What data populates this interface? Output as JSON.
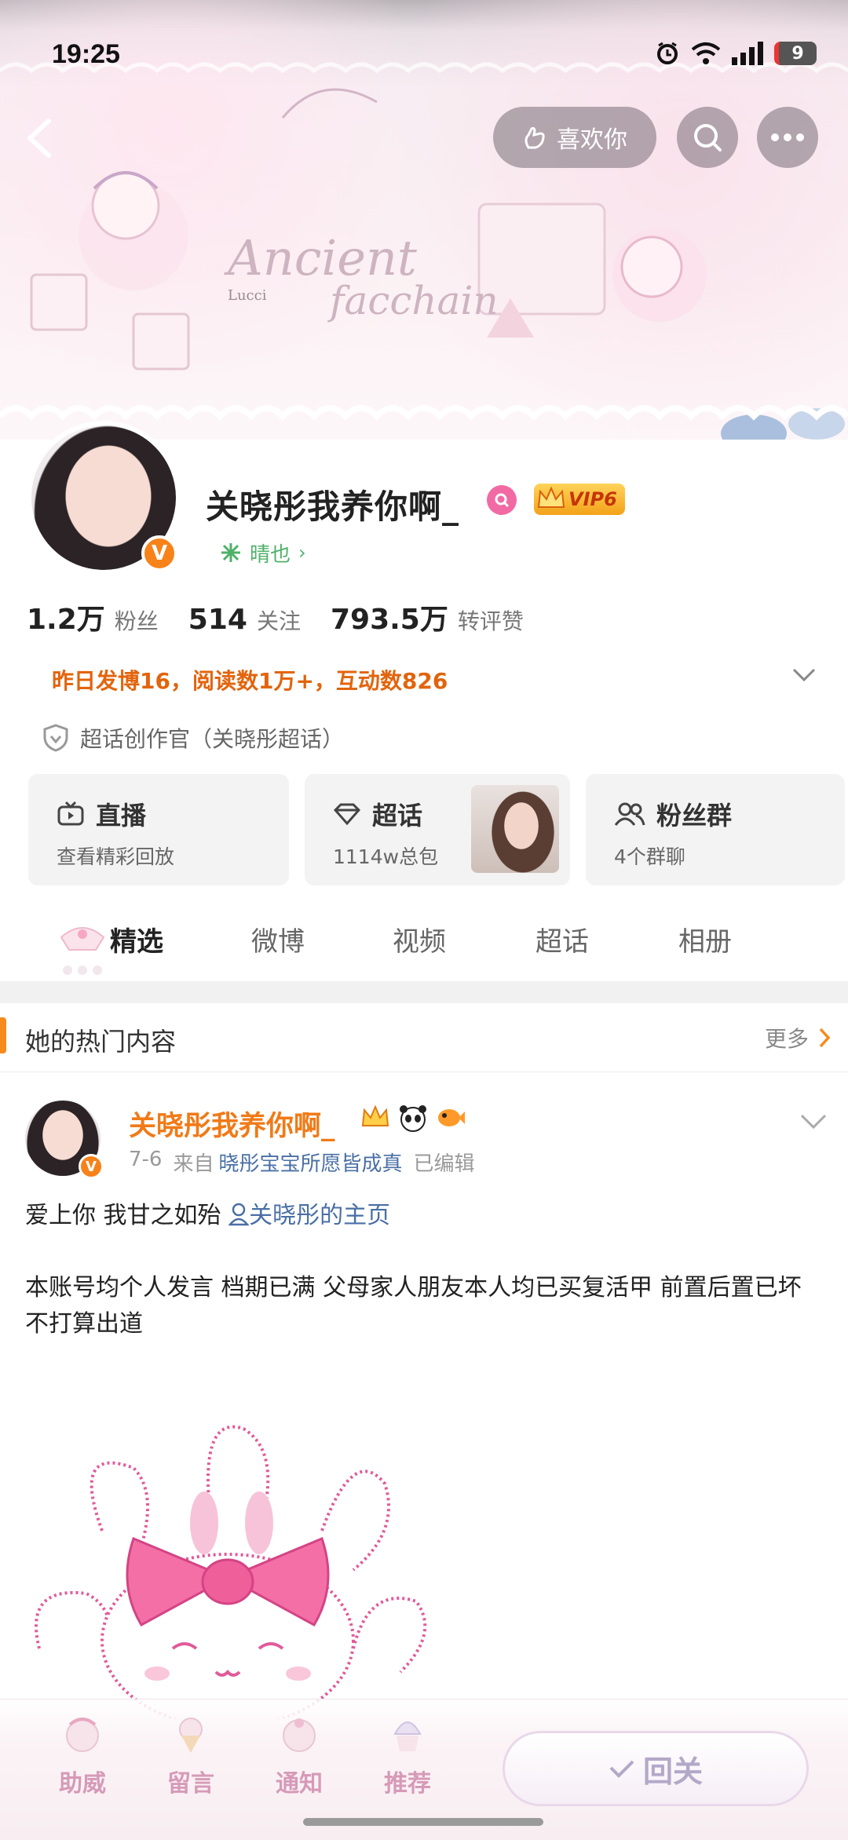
{
  "status_bar": {
    "time": "19:25",
    "battery": "9"
  },
  "nav": {
    "like_label": "喜欢你"
  },
  "banner": {
    "script_title": "Ancient facchain",
    "small_text": "Lucci"
  },
  "profile": {
    "username": "关晓彤我养你啊_",
    "vip_label": "VIP6",
    "tag_label": "晴也",
    "stats": [
      {
        "num": "1.2万",
        "label": "粉丝"
      },
      {
        "num": "514",
        "label": "关注"
      },
      {
        "num": "793.5万",
        "label": "转评赞"
      }
    ],
    "activity": "昨日发博16，阅读数1万+，互动数826",
    "creator": "超话创作官（关晓彤超话）"
  },
  "cards": [
    {
      "title": "直播",
      "sub": "查看精彩回放"
    },
    {
      "title": "超话",
      "sub": "1114w总包"
    },
    {
      "title": "粉丝群",
      "sub": "4个群聊"
    }
  ],
  "tabs": [
    "精选",
    "微博",
    "视频",
    "超话",
    "相册"
  ],
  "hot": {
    "title": "她的热门内容",
    "more": "更多"
  },
  "post": {
    "name": "关晓彤我养你啊_",
    "date": "7-6",
    "from_prefix": "来自",
    "source": "晓彤宝宝所愿皆成真",
    "edited": "已编辑",
    "line1": "爱上你 我甘之如殆",
    "link": "关晓彤的主页",
    "line2": "本账号均个人发言 档期已满 父母家人朋友本人均已买复活甲 前置后置已坏 不打算出道"
  },
  "bottom": {
    "items": [
      "助威",
      "留言",
      "通知",
      "推荐"
    ],
    "follow_back": "回关"
  },
  "colors": {
    "accent_orange": "#f17a17",
    "link_blue": "#4a6fa5",
    "tag_green": "#4fb169",
    "pink": "#f26aa3"
  }
}
